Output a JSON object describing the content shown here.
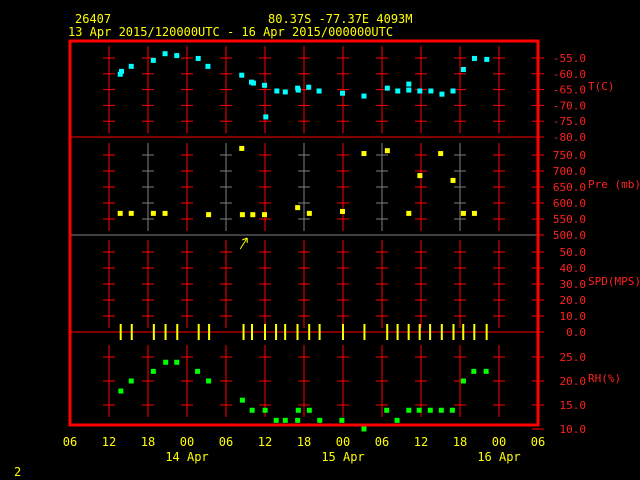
{
  "header": {
    "station": "26407",
    "location": "80.37S  -77.37E  4093M",
    "period": "13 Apr 2015/120000UTC - 16 Apr 2015/000000UTC"
  },
  "footer": {
    "page": "2"
  },
  "colors": {
    "axis": "#ff0000",
    "text": "#ffff00",
    "temp": "#00ffff",
    "pressure": "#ffff00",
    "wind": "#ffff00",
    "rh": "#00ff00",
    "gray": "#808080"
  },
  "chart_data": {
    "type": "scatter",
    "x_unit": "hours since 13 Apr 2015 00UTC",
    "xlim": [
      6,
      78
    ],
    "x_ticks": [
      {
        "h": 6,
        "label": "06"
      },
      {
        "h": 12,
        "label": "12"
      },
      {
        "h": 18,
        "label": "18"
      },
      {
        "h": 24,
        "label": "00"
      },
      {
        "h": 30,
        "label": "06"
      },
      {
        "h": 36,
        "label": "12"
      },
      {
        "h": 42,
        "label": "18"
      },
      {
        "h": 48,
        "label": "00"
      },
      {
        "h": 54,
        "label": "06"
      },
      {
        "h": 60,
        "label": "12"
      },
      {
        "h": 66,
        "label": "18"
      },
      {
        "h": 72,
        "label": "00"
      },
      {
        "h": 78,
        "label": "06"
      }
    ],
    "date_labels": [
      {
        "h": 24,
        "label": "14 Apr"
      },
      {
        "h": 48,
        "label": "15 Apr"
      },
      {
        "h": 72,
        "label": "16 Apr"
      }
    ],
    "panels": [
      {
        "name": "temperature",
        "label": "T(C)",
        "ylim": [
          -80,
          -52.5
        ],
        "ticks": [
          "-55.0",
          "-60.0",
          "-65.0",
          "-70.0",
          "-75.0",
          "-80.0"
        ],
        "tick_values": [
          -55,
          -60,
          -65,
          -70,
          -75,
          -80
        ],
        "points": [
          [
            13.8,
            -60.3
          ],
          [
            14.0,
            -59.4
          ],
          [
            15.5,
            -57.8
          ],
          [
            18.9,
            -55.9
          ],
          [
            20.7,
            -53.8
          ],
          [
            22.5,
            -54.4
          ],
          [
            25.8,
            -55.3
          ],
          [
            27.3,
            -57.8
          ],
          [
            32.5,
            -60.6
          ],
          [
            34.0,
            -62.8
          ],
          [
            34.3,
            -63.1
          ],
          [
            36.0,
            -63.8
          ],
          [
            36.2,
            -73.8
          ],
          [
            37.9,
            -65.6
          ],
          [
            39.2,
            -65.9
          ],
          [
            41.1,
            -64.7
          ],
          [
            41.2,
            -65.3
          ],
          [
            42.8,
            -64.4
          ],
          [
            44.4,
            -65.6
          ],
          [
            48.0,
            -66.3
          ],
          [
            51.3,
            -67.2
          ],
          [
            54.9,
            -64.7
          ],
          [
            56.5,
            -65.6
          ],
          [
            58.2,
            -63.4
          ],
          [
            58.2,
            -65.3
          ],
          [
            59.9,
            -65.6
          ],
          [
            61.6,
            -65.6
          ],
          [
            63.3,
            -66.6
          ],
          [
            65.0,
            -65.6
          ],
          [
            66.6,
            -58.8
          ],
          [
            68.3,
            -55.3
          ],
          [
            70.2,
            -55.6
          ]
        ]
      },
      {
        "name": "pressure",
        "label": "Pre (mb)",
        "ylim": [
          500,
          805
        ],
        "ticks": [
          "750.0",
          "700.0",
          "650.0",
          "600.0",
          "550.0",
          "500.0"
        ],
        "tick_values": [
          750,
          700,
          650,
          600,
          550,
          500
        ],
        "points": [
          [
            13.8,
            566
          ],
          [
            15.5,
            566
          ],
          [
            18.9,
            566
          ],
          [
            20.7,
            566
          ],
          [
            27.4,
            562
          ],
          [
            32.5,
            769
          ],
          [
            32.6,
            562
          ],
          [
            34.2,
            562
          ],
          [
            36.0,
            562
          ],
          [
            41.1,
            584
          ],
          [
            42.9,
            566
          ],
          [
            48.0,
            572
          ],
          [
            51.3,
            753
          ],
          [
            54.9,
            762
          ],
          [
            58.2,
            566
          ],
          [
            59.9,
            684
          ],
          [
            63.1,
            753
          ],
          [
            65.0,
            669
          ],
          [
            66.6,
            566
          ],
          [
            68.3,
            566
          ]
        ]
      },
      {
        "name": "wind-speed",
        "label": "SPD(MPS)",
        "ylim": [
          0,
          55
        ],
        "ticks": [
          "50.0",
          "40.0",
          "30.0",
          "20.0",
          "10.0",
          "0.0"
        ],
        "tick_values": [
          50,
          40,
          30,
          20,
          10,
          0
        ],
        "points": [
          [
            13.8,
            0
          ],
          [
            15.5,
            0
          ],
          [
            18.9,
            0
          ],
          [
            20.7,
            0
          ],
          [
            22.5,
            0
          ],
          [
            25.8,
            0
          ],
          [
            27.4,
            0
          ],
          [
            32.7,
            0
          ],
          [
            34.0,
            0
          ],
          [
            36.0,
            0
          ],
          [
            37.7,
            0
          ],
          [
            39.1,
            0
          ],
          [
            41.0,
            0
          ],
          [
            42.8,
            0
          ],
          [
            44.4,
            0
          ],
          [
            48.0,
            0
          ],
          [
            51.3,
            0
          ],
          [
            54.8,
            0
          ],
          [
            56.4,
            0
          ],
          [
            58.1,
            0
          ],
          [
            59.8,
            0
          ],
          [
            61.4,
            0
          ],
          [
            63.2,
            0
          ],
          [
            65.0,
            0
          ],
          [
            66.5,
            0
          ],
          [
            68.2,
            0
          ],
          [
            70.1,
            0
          ]
        ],
        "annotation_arrow_h": 32.8
      },
      {
        "name": "relative-humidity",
        "label": "RH(%)",
        "ylim": [
          9.2,
          25
        ],
        "ticks": [
          "25.0",
          "20.0",
          "15.0",
          "10.0"
        ],
        "tick_values": [
          25,
          20,
          15,
          10
        ],
        "points": [
          [
            13.9,
            17.8
          ],
          [
            15.5,
            19.9
          ],
          [
            18.9,
            21.9
          ],
          [
            20.8,
            23.8
          ],
          [
            22.5,
            23.8
          ],
          [
            25.7,
            21.9
          ],
          [
            27.4,
            19.9
          ],
          [
            32.6,
            15.9
          ],
          [
            34.1,
            13.8
          ],
          [
            36.1,
            13.8
          ],
          [
            37.8,
            11.7
          ],
          [
            39.2,
            11.7
          ],
          [
            41.1,
            11.7
          ],
          [
            41.2,
            13.8
          ],
          [
            42.9,
            13.8
          ],
          [
            44.5,
            11.7
          ],
          [
            47.9,
            11.7
          ],
          [
            51.3,
            9.9
          ],
          [
            54.8,
            13.8
          ],
          [
            56.4,
            11.7
          ],
          [
            58.2,
            13.8
          ],
          [
            59.8,
            13.8
          ],
          [
            61.5,
            13.8
          ],
          [
            63.2,
            13.8
          ],
          [
            64.9,
            13.8
          ],
          [
            66.6,
            19.9
          ],
          [
            68.2,
            21.9
          ],
          [
            70.1,
            21.9
          ]
        ]
      }
    ]
  }
}
